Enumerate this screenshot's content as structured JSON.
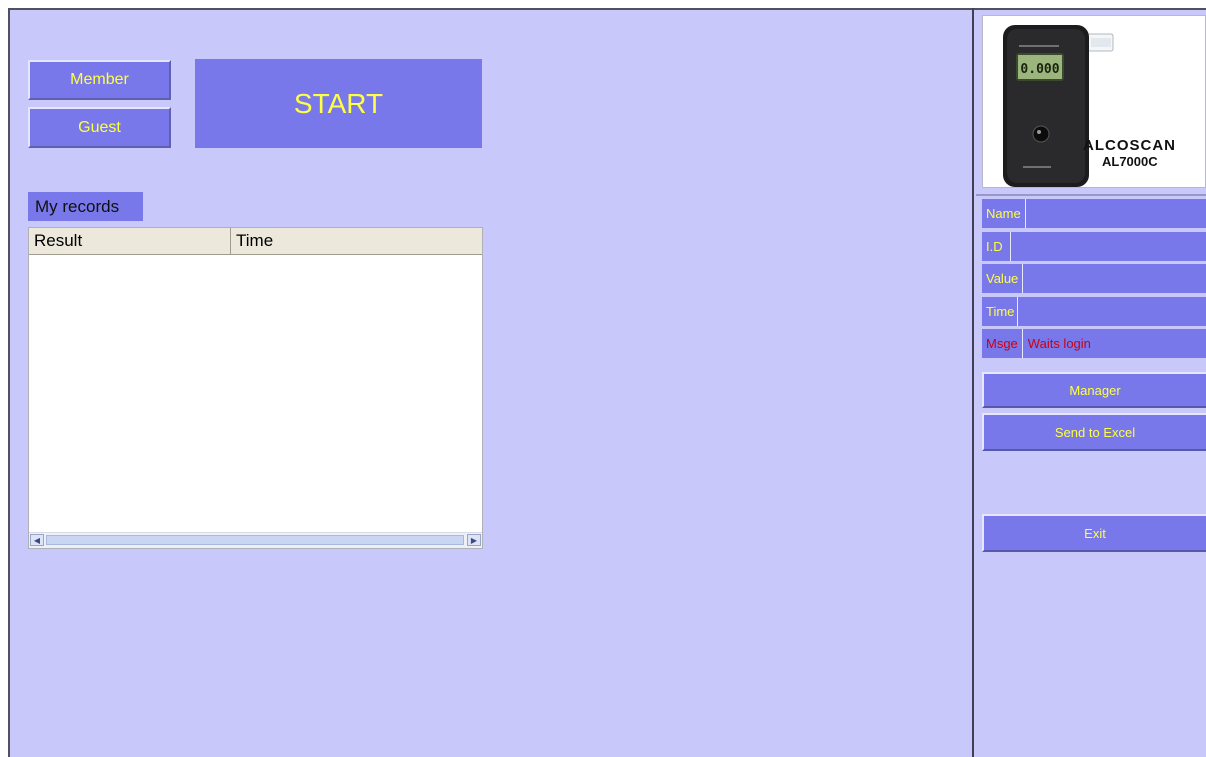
{
  "buttons": {
    "member": "Member",
    "guest": "Guest",
    "start": "START"
  },
  "records": {
    "title": "My records",
    "columns": [
      "Result",
      "Time"
    ],
    "rows": []
  },
  "device": {
    "brand": "ALCOSCAN",
    "model": "AL7000C",
    "display_reading": "0.000"
  },
  "info": {
    "name_label": "Name",
    "name_value": "",
    "id_label": "I.D",
    "id_value": "",
    "value_label": "Value",
    "value_value": "",
    "time_label": "Time",
    "time_value": "",
    "msge_label": "Msge",
    "msge_value": "Waits login"
  },
  "panel_buttons": {
    "manager": "Manager",
    "excel": "Send to Excel",
    "exit": "Exit"
  },
  "colors": {
    "background": "#c8c8fa",
    "button": "#7878ea",
    "button_text": "#ffff44",
    "message_text": "#cc0010"
  }
}
